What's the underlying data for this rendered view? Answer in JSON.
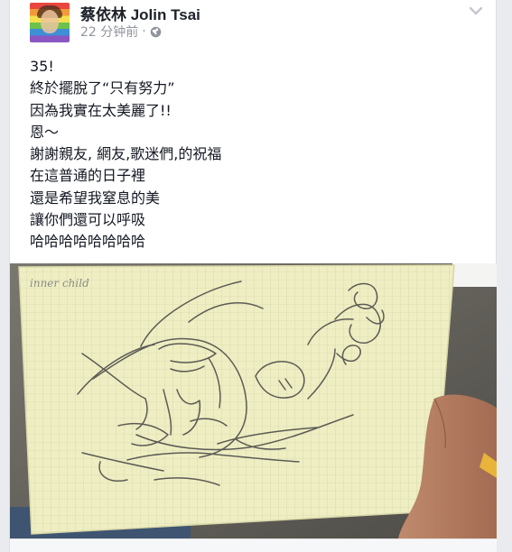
{
  "post": {
    "author_name": "蔡依林 Jolin Tsai",
    "timestamp": "22 分钟前",
    "separator": "·",
    "privacy_icon": "globe-icon",
    "menu_icon": "chevron-down-icon",
    "lines": [
      "35!",
      "終於擺脫了“只有努力”",
      "因為我實在太美麗了!!",
      "恩～",
      "謝謝親友, 網友,歌迷們,的祝福",
      "在這普通的日子裡",
      "還是希望我窒息的美",
      "讓你們還可以呼吸",
      "哈哈哈哈哈哈哈哈"
    ]
  },
  "photo": {
    "notebook_label": "inner child",
    "paper_color": "#efeec2",
    "grid_color": "#c9cfa8",
    "pencil_color": "#5b5b55"
  }
}
